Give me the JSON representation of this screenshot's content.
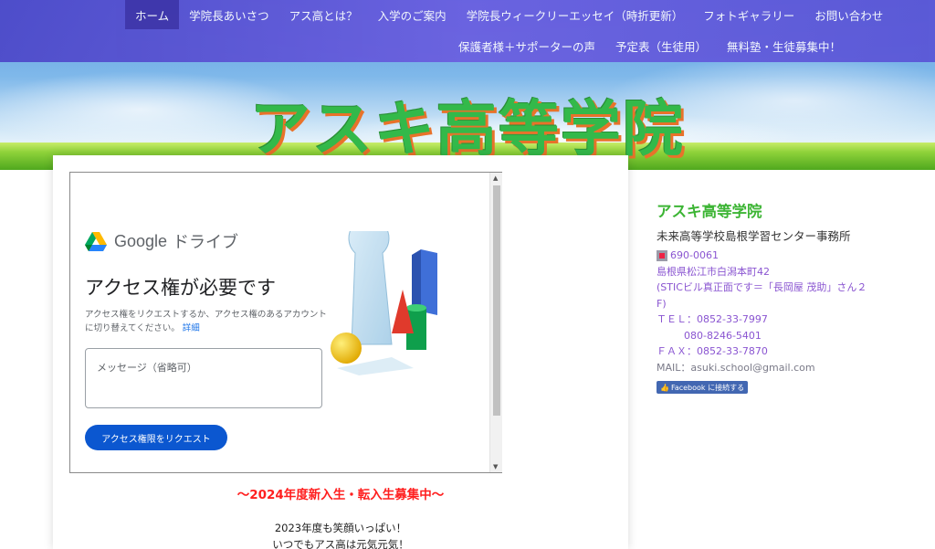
{
  "nav": {
    "row1": [
      "ホーム",
      "学院長あいさつ",
      "アス高とは？",
      "入学のご案内",
      "学院長ウィークリーエッセイ（時折更新）",
      "フォトギャラリー",
      "お問い合わせ"
    ],
    "row2": [
      "保護者様＋サポーターの声",
      "予定表（生徒用）",
      "無料塾・生徒募集中！"
    ]
  },
  "site_title": "アスキ高等学院",
  "drive": {
    "brand": "Google",
    "product": "ドライブ",
    "heading": "アクセス権が必要です",
    "description": "アクセス権をリクエストするか、アクセス権のあるアカウントに切り替えてください。",
    "details_link": "詳細",
    "message_placeholder": "メッセージ（省略可）",
    "request_button": "アクセス権限をリクエスト"
  },
  "main": {
    "recruit": "〜2024年度新入生・転入生募集中〜",
    "smile": "2023年度も笑顔いっぱい！",
    "genki": "いつでもアス高は元気元気！"
  },
  "sidebar": {
    "school_name": "アスキ高等学院",
    "office": "未来高等学校島根学習センター事務所",
    "postal": "690-0061",
    "address1": "島根県松江市白潟本町42",
    "address2": "(STICビル真正面です＝「長岡屋 茂助」さん２",
    "address3": "F)",
    "tel1": "ＴＥＬ：0852-33-7997",
    "tel2": "080-8246-5401",
    "fax": "ＦＡＸ：0852-33-7870",
    "mail": "MAIL：asuki.school@gmail.com",
    "facebook": "Facebook に接続する"
  },
  "colors": {
    "nav": "#5a54d6",
    "nav_active": "#3d2fa8",
    "title_green": "#33b94a",
    "recruit_red": "#ff1f1f",
    "sidebar_link": "#8a55d1",
    "request_blue": "#0b57d0"
  },
  "icons": [
    "google-drive-icon",
    "building-icon",
    "facebook-like-icon"
  ]
}
